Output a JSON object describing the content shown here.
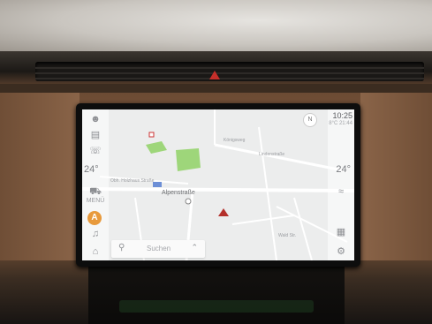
{
  "status": {
    "time": "10:25",
    "time_sub": "8°C  21:44"
  },
  "climate": {
    "left_temp": "24",
    "right_temp": "24",
    "left_unit": "°",
    "right_unit": "°"
  },
  "map": {
    "road_main": "Alpenstraße",
    "road_upper": "Obh. Holzhaus Straße",
    "road_right": "Lindenstraße",
    "road_bottom": "Wald Str.",
    "road_small": "Königsweg"
  },
  "search": {
    "placeholder": "Suchen"
  },
  "left_rail": {
    "items": [
      {
        "icon": "person-icon",
        "label": ""
      },
      {
        "icon": "media-icon",
        "label": ""
      },
      {
        "icon": "phone-icon",
        "label": ""
      },
      {
        "icon": "car-icon",
        "label": "MENÜ"
      },
      {
        "icon": "music-icon",
        "label": ""
      },
      {
        "icon": "home-icon",
        "label": ""
      }
    ],
    "active_badge": "A"
  },
  "right_rail": {
    "items": [
      "seat-heat-icon",
      "settings-icon",
      "nav-mode-icon"
    ]
  },
  "colors": {
    "route_red": "#b4302b",
    "accent_orange": "#e89a3c",
    "park_green": "#9ed67a"
  }
}
